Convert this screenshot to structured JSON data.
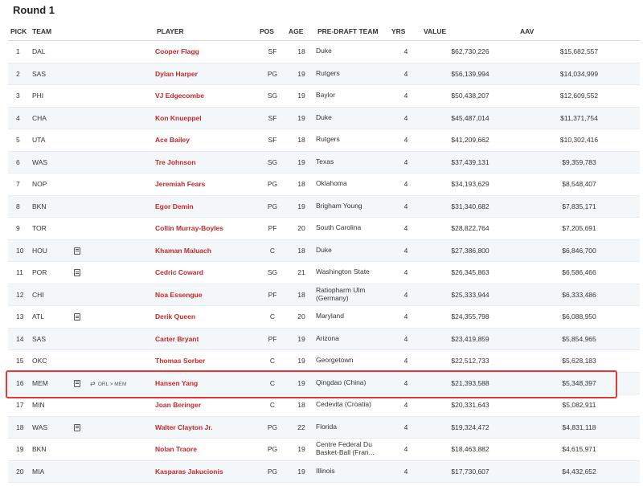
{
  "round_title": "Round 1",
  "columns": {
    "pick": "PICK",
    "team": "TEAM",
    "player": "PLAYER",
    "pos": "POS",
    "age": "AGE",
    "pre_draft_team": "PRE-DRAFT TEAM",
    "yrs": "YRS",
    "value": "VALUE",
    "aav": "AAV"
  },
  "rows": [
    {
      "pick": "1",
      "team": "DAL",
      "note_icon": false,
      "trade": "",
      "player": "Cooper Flagg",
      "pos": "SF",
      "age": "18",
      "pre_draft_team": "Duke",
      "yrs": "4",
      "value": "$62,730,226",
      "aav": "$15,682,557"
    },
    {
      "pick": "2",
      "team": "SAS",
      "note_icon": false,
      "trade": "",
      "player": "Dylan Harper",
      "pos": "PG",
      "age": "19",
      "pre_draft_team": "Rutgers",
      "yrs": "4",
      "value": "$56,139,994",
      "aav": "$14,034,999"
    },
    {
      "pick": "3",
      "team": "PHI",
      "note_icon": false,
      "trade": "",
      "player": "VJ Edgecombe",
      "pos": "SG",
      "age": "19",
      "pre_draft_team": "Baylor",
      "yrs": "4",
      "value": "$50,438,207",
      "aav": "$12,609,552"
    },
    {
      "pick": "4",
      "team": "CHA",
      "note_icon": false,
      "trade": "",
      "player": "Kon Knueppel",
      "pos": "SF",
      "age": "19",
      "pre_draft_team": "Duke",
      "yrs": "4",
      "value": "$45,487,014",
      "aav": "$11,371,754"
    },
    {
      "pick": "5",
      "team": "UTA",
      "note_icon": false,
      "trade": "",
      "player": "Ace Bailey",
      "pos": "SF",
      "age": "18",
      "pre_draft_team": "Rutgers",
      "yrs": "4",
      "value": "$41,209,662",
      "aav": "$10,302,416"
    },
    {
      "pick": "6",
      "team": "WAS",
      "note_icon": false,
      "trade": "",
      "player": "Tre Johnson",
      "pos": "SG",
      "age": "19",
      "pre_draft_team": "Texas",
      "yrs": "4",
      "value": "$37,439,131",
      "aav": "$9,359,783"
    },
    {
      "pick": "7",
      "team": "NOP",
      "note_icon": false,
      "trade": "",
      "player": "Jeremiah Fears",
      "pos": "PG",
      "age": "18",
      "pre_draft_team": "Oklahoma",
      "yrs": "4",
      "value": "$34,193,629",
      "aav": "$8,548,407"
    },
    {
      "pick": "8",
      "team": "BKN",
      "note_icon": false,
      "trade": "",
      "player": "Egor Demin",
      "pos": "PG",
      "age": "19",
      "pre_draft_team": "Brigham Young",
      "yrs": "4",
      "value": "$31,340,682",
      "aav": "$7,835,171"
    },
    {
      "pick": "9",
      "team": "TOR",
      "note_icon": false,
      "trade": "",
      "player": "Collin Murray-Boyles",
      "pos": "PF",
      "age": "20",
      "pre_draft_team": "South Carolina",
      "yrs": "4",
      "value": "$28,822,764",
      "aav": "$7,205,691"
    },
    {
      "pick": "10",
      "team": "HOU",
      "note_icon": true,
      "trade": "",
      "player": "Khaman Maluach",
      "pos": "C",
      "age": "18",
      "pre_draft_team": "Duke",
      "yrs": "4",
      "value": "$27,386,800",
      "aav": "$6,846,700"
    },
    {
      "pick": "11",
      "team": "POR",
      "note_icon": true,
      "trade": "",
      "player": "Cedric Coward",
      "pos": "SG",
      "age": "21",
      "pre_draft_team": "Washington State",
      "yrs": "4",
      "value": "$26,345,863",
      "aav": "$6,586,466"
    },
    {
      "pick": "12",
      "team": "CHI",
      "note_icon": false,
      "trade": "",
      "player": "Noa Essengue",
      "pos": "PF",
      "age": "18",
      "pre_draft_team": "Ratiopharm Ulm (Germany)",
      "yrs": "4",
      "value": "$25,333,944",
      "aav": "$6,333,486"
    },
    {
      "pick": "13",
      "team": "ATL",
      "note_icon": true,
      "trade": "",
      "player": "Derik Queen",
      "pos": "C",
      "age": "20",
      "pre_draft_team": "Maryland",
      "yrs": "4",
      "value": "$24,355,798",
      "aav": "$6,088,950"
    },
    {
      "pick": "14",
      "team": "SAS",
      "note_icon": false,
      "trade": "",
      "player": "Carter Bryant",
      "pos": "PF",
      "age": "19",
      "pre_draft_team": "Arizona",
      "yrs": "4",
      "value": "$23,419,859",
      "aav": "$5,854,965"
    },
    {
      "pick": "15",
      "team": "OKC",
      "note_icon": false,
      "trade": "",
      "player": "Thomas Sorber",
      "pos": "C",
      "age": "19",
      "pre_draft_team": "Georgetown",
      "yrs": "4",
      "value": "$22,512,733",
      "aav": "$5,628,183"
    },
    {
      "pick": "16",
      "team": "MEM",
      "note_icon": true,
      "trade": "ORL > MEM",
      "player": "Hansen Yang",
      "pos": "C",
      "age": "19",
      "pre_draft_team": "Qingdao (China)",
      "yrs": "4",
      "value": "$21,393,588",
      "aav": "$5,348,397",
      "highlighted": true
    },
    {
      "pick": "17",
      "team": "MIN",
      "note_icon": false,
      "trade": "",
      "player": "Joan Beringer",
      "pos": "C",
      "age": "18",
      "pre_draft_team": "Cedevita (Croatia)",
      "yrs": "4",
      "value": "$20,331,643",
      "aav": "$5,082,911"
    },
    {
      "pick": "18",
      "team": "WAS",
      "note_icon": true,
      "trade": "",
      "player": "Walter Clayton Jr.",
      "pos": "PG",
      "age": "22",
      "pre_draft_team": "Florida",
      "yrs": "4",
      "value": "$19,324,472",
      "aav": "$4,831,118"
    },
    {
      "pick": "19",
      "team": "BKN",
      "note_icon": false,
      "trade": "",
      "player": "Nolan Traore",
      "pos": "PG",
      "age": "19",
      "pre_draft_team": "Centre Federal Du Basket-Ball (Fran...",
      "yrs": "4",
      "value": "$18,463,882",
      "aav": "$4,615,971"
    },
    {
      "pick": "20",
      "team": "MIA",
      "note_icon": false,
      "trade": "",
      "player": "Kasparas Jakucionis",
      "pos": "PG",
      "age": "19",
      "pre_draft_team": "Illinois",
      "yrs": "4",
      "value": "$17,730,607",
      "aav": "$4,432,652"
    }
  ]
}
